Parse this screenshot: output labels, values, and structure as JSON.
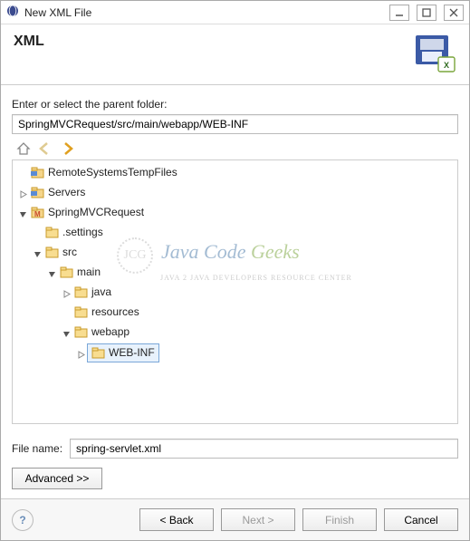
{
  "window": {
    "title": "New XML File"
  },
  "header": {
    "title": "XML"
  },
  "labels": {
    "parent_folder": "Enter or select the parent folder:",
    "file_name": "File name:"
  },
  "fields": {
    "parent_folder_value": "SpringMVCRequest/src/main/webapp/WEB-INF",
    "file_name_value": "spring-servlet.xml"
  },
  "tree": {
    "items": [
      {
        "label": "RemoteSystemsTempFiles",
        "icon": "project",
        "twist": "none",
        "depth": 0
      },
      {
        "label": "Servers",
        "icon": "project",
        "twist": "closed",
        "depth": 0
      },
      {
        "label": "SpringMVCRequest",
        "icon": "mvn-project",
        "twist": "open",
        "depth": 0
      },
      {
        "label": ".settings",
        "icon": "folder",
        "twist": "none",
        "depth": 1
      },
      {
        "label": "src",
        "icon": "folder",
        "twist": "open",
        "depth": 1
      },
      {
        "label": "main",
        "icon": "folder",
        "twist": "open",
        "depth": 2
      },
      {
        "label": "java",
        "icon": "folder",
        "twist": "closed",
        "depth": 3
      },
      {
        "label": "resources",
        "icon": "folder",
        "twist": "none",
        "depth": 3
      },
      {
        "label": "webapp",
        "icon": "folder",
        "twist": "open",
        "depth": 3
      },
      {
        "label": "WEB-INF",
        "icon": "folder",
        "twist": "closed",
        "depth": 4,
        "selected": true
      }
    ]
  },
  "buttons": {
    "advanced": "Advanced >>",
    "back": "< Back",
    "next": "Next >",
    "finish": "Finish",
    "cancel": "Cancel"
  },
  "watermark": {
    "line1_a": "Java",
    "line1_b": "Code",
    "line1_c": "Geeks",
    "line2": "JAVA 2 JAVA DEVELOPERS RESOURCE CENTER",
    "logo": "JCG"
  }
}
